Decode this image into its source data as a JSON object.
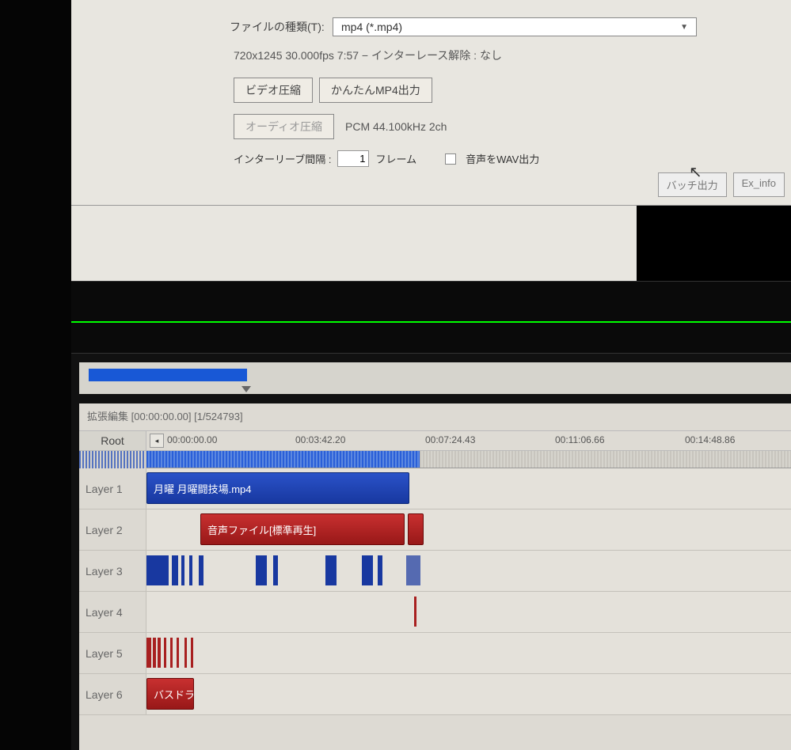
{
  "dialog": {
    "file_type_label": "ファイルの種類(T):",
    "file_type_value": "mp4 (*.mp4)",
    "info_line": "720x1245  30.000fps  7:57  −  インターレース解除 : なし",
    "video_compress_btn": "ビデオ圧縮",
    "easy_mp4_btn": "かんたんMP4出力",
    "audio_compress_btn": "オーディオ圧縮",
    "audio_codec_text": "PCM 44.100kHz 2ch",
    "interleave_label": "インターリーブ間隔 :",
    "interleave_value": "1",
    "interleave_unit": "フレーム",
    "wav_out_label": "音声をWAV出力",
    "batch_btn": "バッチ出力",
    "exinfo_btn": "Ex_info"
  },
  "timeline_header": "拡張編集 [00:00:00.00] [1/524793]",
  "root_label": "Root",
  "ruler_ticks": [
    "00:00:00.00",
    "00:03:42.20",
    "00:07:24.43",
    "00:11:06.66",
    "00:14:48.86"
  ],
  "layers": [
    {
      "name": "Layer 1"
    },
    {
      "name": "Layer 2"
    },
    {
      "name": "Layer 3"
    },
    {
      "name": "Layer 4"
    },
    {
      "name": "Layer 5"
    },
    {
      "name": "Layer 6"
    }
  ],
  "clips": {
    "layer1_video": "月曜 月曜闘技場.mp4",
    "layer2_audio": "音声ファイル[標準再生]",
    "layer6_drum": "バスドラ"
  }
}
